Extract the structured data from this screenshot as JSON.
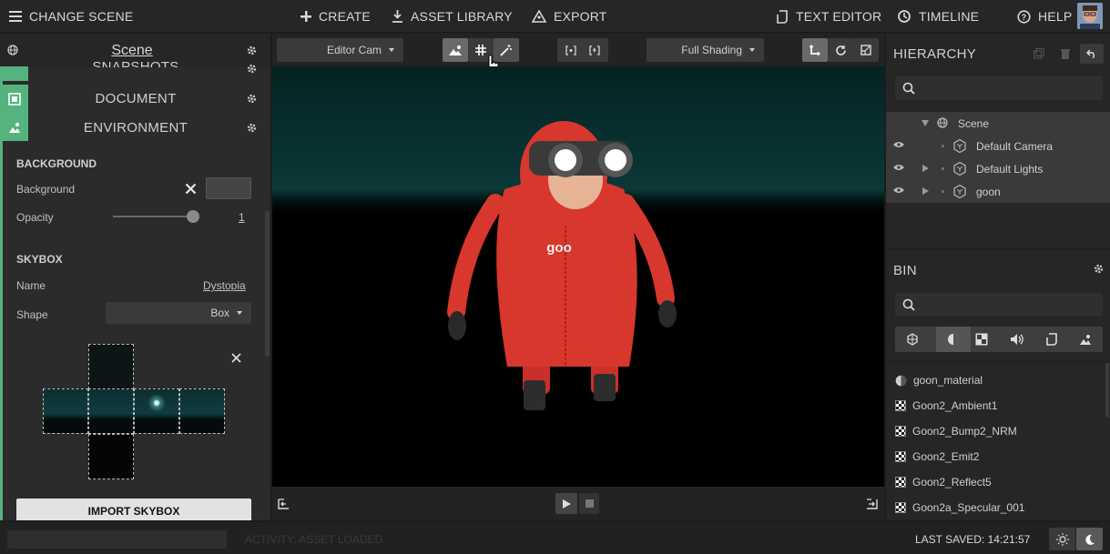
{
  "topbar": {
    "change_scene": "CHANGE SCENE",
    "create": "CREATE",
    "asset_library": "ASSET LIBRARY",
    "export": "EXPORT",
    "text_editor": "TEXT EDITOR",
    "timeline": "TIMELINE",
    "help": "HELP"
  },
  "left": {
    "scene_title": "Scene",
    "sections": {
      "snapshots": "SNAPSHOTS",
      "document": "DOCUMENT",
      "environment": "ENVIRONMENT"
    },
    "background": {
      "header": "BACKGROUND",
      "background_label": "Background",
      "opacity_label": "Opacity",
      "opacity_value": "1",
      "opacity_fraction": 1.0
    },
    "skybox": {
      "header": "SKYBOX",
      "name_label": "Name",
      "name_value": "Dystopia",
      "shape_label": "Shape",
      "shape_value": "Box"
    },
    "import_button": "IMPORT SKYBOX"
  },
  "viewport": {
    "camera": "Editor Cam",
    "shading": "Full Shading"
  },
  "hierarchy": {
    "title": "HIERARCHY",
    "items": [
      {
        "label": "Scene"
      },
      {
        "label": "Default Camera"
      },
      {
        "label": "Default Lights"
      },
      {
        "label": "goon"
      }
    ]
  },
  "bin": {
    "title": "BIN",
    "items": [
      {
        "label": "goon_material",
        "icon": "material-icon"
      },
      {
        "label": "Goon2_Ambient1",
        "icon": "texture-icon"
      },
      {
        "label": "Goon2_Bump2_NRM",
        "icon": "texture-icon"
      },
      {
        "label": "Goon2_Emit2",
        "icon": "texture-icon"
      },
      {
        "label": "Goon2_Reflect5",
        "icon": "texture-icon"
      },
      {
        "label": "Goon2a_Specular_001",
        "icon": "texture-icon"
      }
    ]
  },
  "status": {
    "activity": "ACTIVITY: ASSET LOADED",
    "last_saved": "LAST SAVED: 14:21:57"
  },
  "colors": {
    "accent_green": "#54b37f",
    "character_red": "#d8372d",
    "skybox_teal": "#0b3838"
  }
}
